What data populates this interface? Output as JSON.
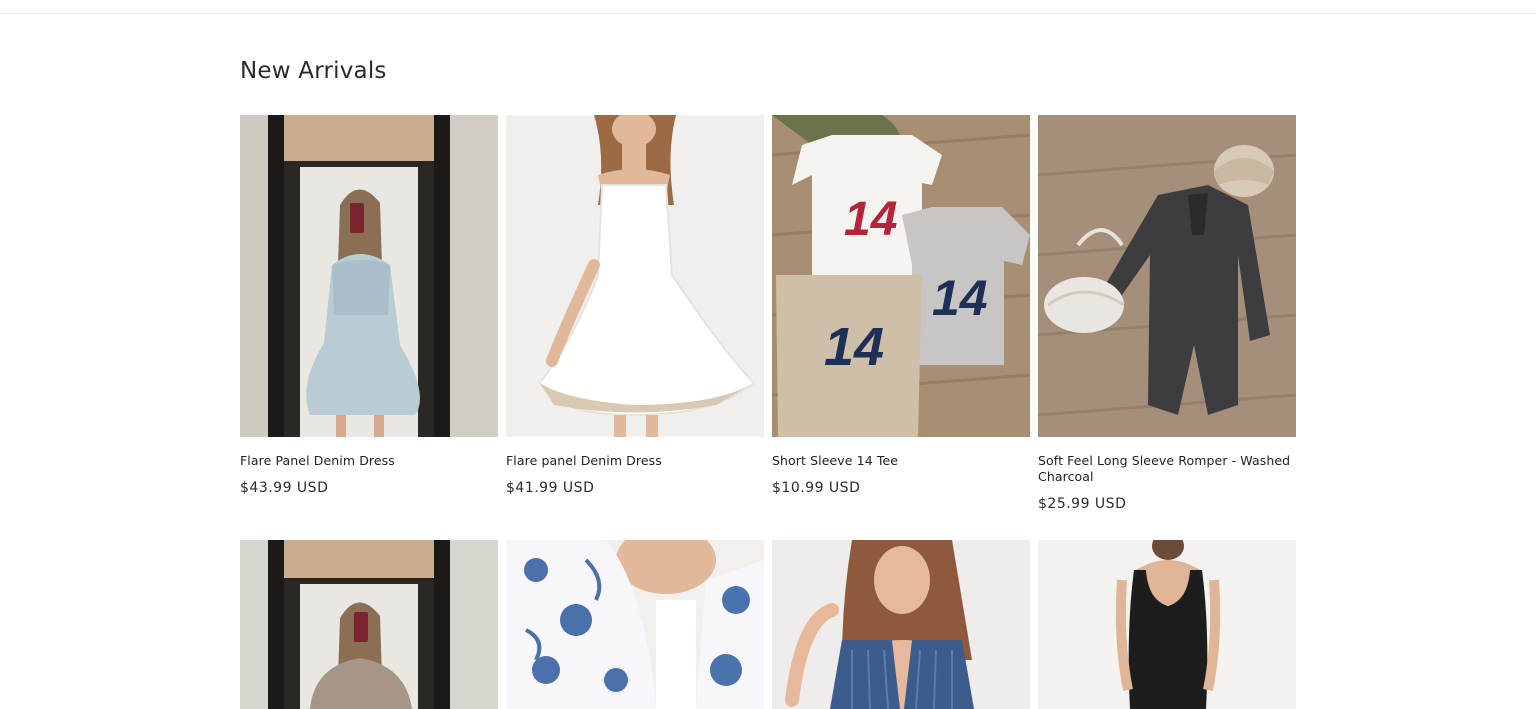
{
  "section": {
    "title": "New Arrivals"
  },
  "products_row1": [
    {
      "title": "Flare Panel Denim Dress",
      "price": "$43.99 USD",
      "image": "mirror-selfie-denim-dress"
    },
    {
      "title": "Flare panel Denim Dress",
      "price": "$41.99 USD",
      "image": "white-flare-dress"
    },
    {
      "title": "Short Sleeve 14 Tee",
      "price": "$10.99 USD",
      "image": "number-14-tees-flatlay"
    },
    {
      "title": "Soft Feel Long Sleeve Romper - Washed Charcoal",
      "price": "$25.99 USD",
      "image": "charcoal-romper-flatlay"
    }
  ],
  "products_row2": [
    {
      "image": "mirror-selfie-taupe-top"
    },
    {
      "image": "blue-floral-kimono"
    },
    {
      "image": "denim-vest-model"
    },
    {
      "image": "black-tank-dress"
    }
  ],
  "colors": {
    "text": "#121212",
    "price": "#2c2c2c",
    "divider": "#e8e8e8"
  }
}
